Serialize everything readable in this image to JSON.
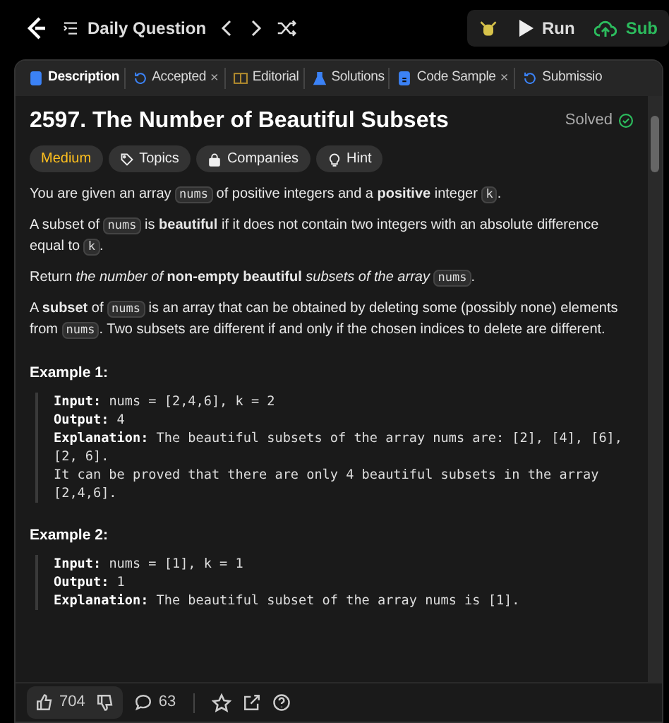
{
  "toolbar": {
    "list_label": "Daily Question",
    "run_label": "Run",
    "submit_label": "Sub"
  },
  "tabs": [
    {
      "label": "Description",
      "selected": true
    },
    {
      "label": "Accepted",
      "selected": false,
      "close": "×"
    },
    {
      "label": "Editorial",
      "selected": false
    },
    {
      "label": "Solutions",
      "selected": false
    },
    {
      "label": "Code Sample",
      "selected": false,
      "close": "×"
    },
    {
      "label": "Submissio",
      "selected": false
    }
  ],
  "problem": {
    "title": "2597. The Number of Beautiful Subsets",
    "status": "Solved",
    "difficulty": "Medium",
    "tags": [
      "Topics",
      "Companies",
      "Hint"
    ],
    "paragraphs": [
      [
        {
          "kind": "text",
          "text": "You are given an array "
        },
        {
          "kind": "code",
          "text": "nums"
        },
        {
          "kind": "text",
          "text": " of positive integers and a **positive** integer "
        },
        {
          "kind": "code",
          "text": "k"
        },
        {
          "kind": "text",
          "text": "."
        }
      ],
      [
        {
          "kind": "text",
          "text": "A subset of "
        },
        {
          "kind": "code",
          "text": "nums"
        },
        {
          "kind": "text",
          "text": " is **beautiful** if it does not contain two integers with an absolute difference equal to "
        },
        {
          "kind": "code",
          "text": "k"
        },
        {
          "kind": "text",
          "text": "."
        }
      ],
      [
        {
          "kind": "text",
          "text": "Return *the number of* **non-empty beautiful** *subsets of the array* "
        },
        {
          "kind": "code",
          "text": "nums"
        },
        {
          "kind": "text",
          "text": "."
        }
      ],
      [
        {
          "kind": "text",
          "text": "A **subset** of "
        },
        {
          "kind": "code",
          "text": "nums"
        },
        {
          "kind": "text",
          "text": " is an array that can be obtained by deleting some (possibly none) elements from "
        },
        {
          "kind": "code",
          "text": "nums"
        },
        {
          "kind": "text",
          "text": ". Two subsets are different if and only if the chosen indices to delete are different."
        }
      ]
    ],
    "examples": [
      {
        "heading": "Example 1:",
        "lines": [
          "**Input:** nums = [2,4,6], k = 2",
          "**Output:** 4",
          "**Explanation:** The beautiful subsets of the array nums are: [2], [4], [6], [2, 6].",
          "It can be proved that there are only 4 beautiful subsets in the array [2,4,6]."
        ]
      },
      {
        "heading": "Example 2:",
        "lines": [
          "**Input:** nums = [1], k = 1",
          "**Output:** 1",
          "**Explanation:** The beautiful subset of the array nums is [1]."
        ]
      }
    ]
  },
  "footer": {
    "likes": "704",
    "comments": "63"
  }
}
